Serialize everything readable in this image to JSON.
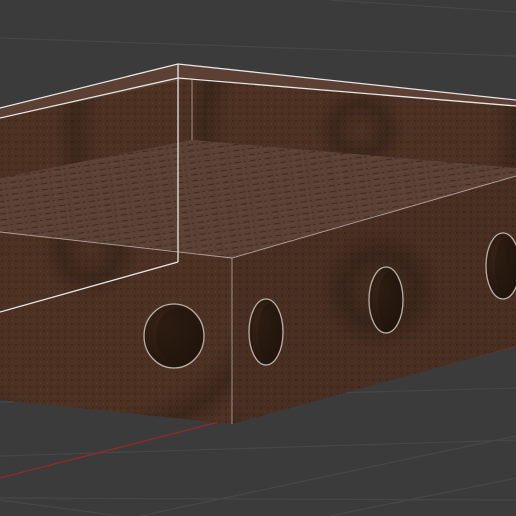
{
  "viewport": {
    "background": "#3b3b3b",
    "grid_color": "#474747",
    "x_axis_color": "#8e2b2b",
    "selection_outline_color": "#e6e6e6"
  },
  "object": {
    "material_base": "#4f3424",
    "material_dark": "#3a2518",
    "hole_count": 5
  }
}
